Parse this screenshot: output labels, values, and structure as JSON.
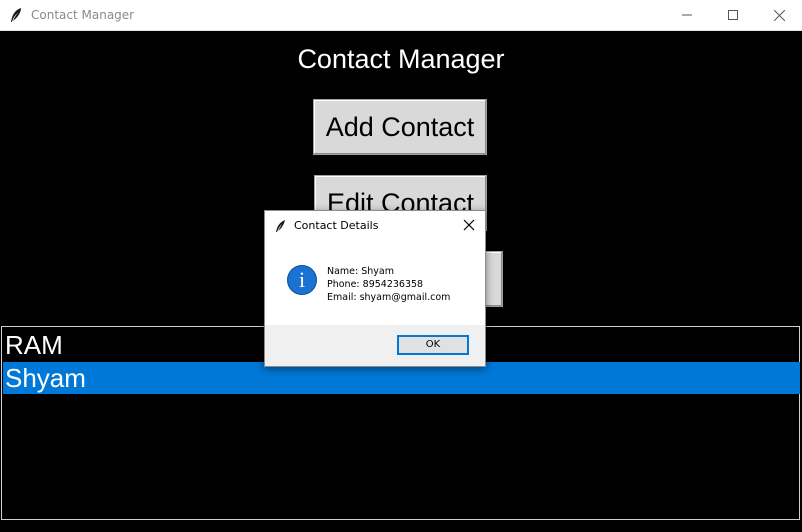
{
  "window": {
    "title": "Contact Manager",
    "controls": {
      "minimize": "minimize-icon",
      "maximize": "maximize-icon",
      "close": "close-icon"
    }
  },
  "app": {
    "heading": "Contact Manager",
    "buttons": {
      "add": "Add Contact",
      "edit": "Edit Contact",
      "delete_visible": "t"
    },
    "contacts": [
      {
        "name": "RAM",
        "selected": false
      },
      {
        "name": "Shyam",
        "selected": true
      }
    ]
  },
  "dialog": {
    "title": "Contact Details",
    "icon": "info-icon",
    "icon_glyph": "i",
    "lines": [
      "Name: Shyam",
      "Phone: 8954236358",
      "Email: shyam@gmail.com"
    ],
    "ok_label": "OK"
  },
  "colors": {
    "background": "#000000",
    "selection": "#0078d7",
    "button_face": "#d9d9d9",
    "info_icon": "#1a73d1"
  }
}
